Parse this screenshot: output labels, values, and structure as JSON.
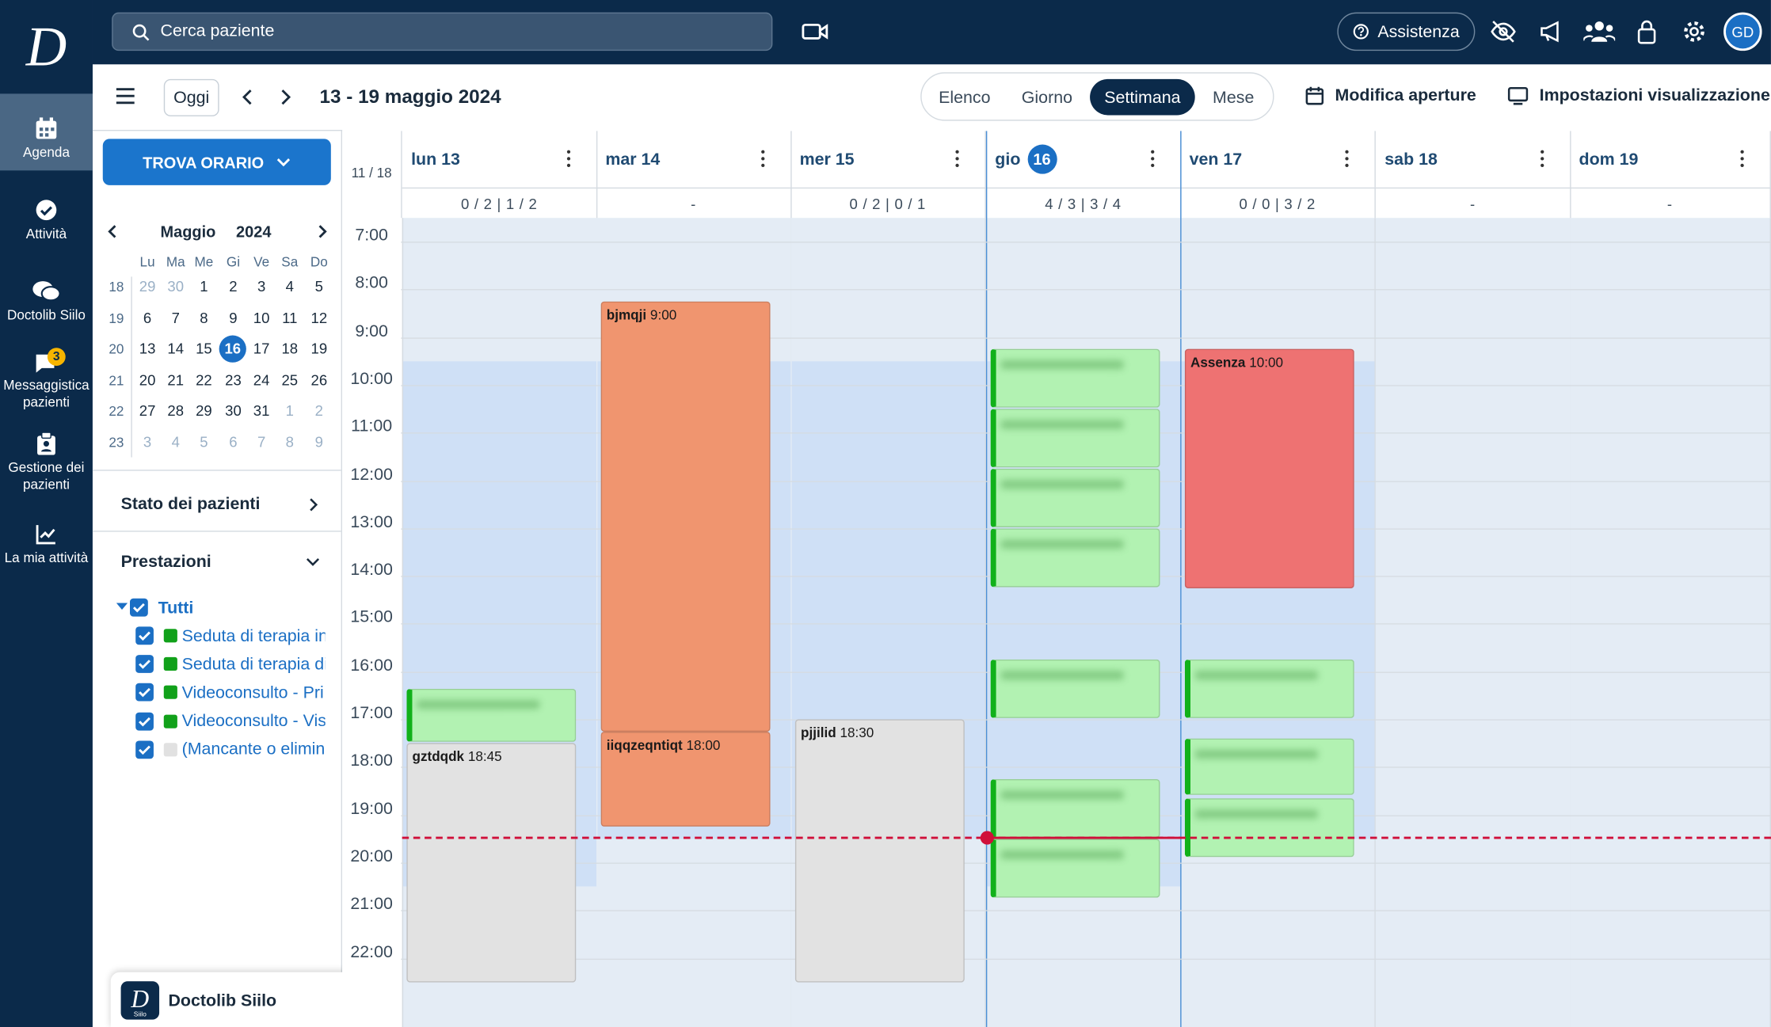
{
  "app": {
    "logo_letter": "D"
  },
  "search": {
    "placeholder": "Cerca paziente"
  },
  "topbar": {
    "assist_label": "Assistenza",
    "avatar_initials": "GD"
  },
  "nav": {
    "agenda": "Agenda",
    "attivita": "Attività",
    "siilo": "Doctolib Siilo",
    "messaggistica_1": "Messaggistica",
    "messaggistica_2": "pazienti",
    "messaggistica_badge": "3",
    "gestione_1": "Gestione dei",
    "gestione_2": "pazienti",
    "mia_attivita": "La mia attività"
  },
  "toolbar": {
    "oggi": "Oggi",
    "date_range": "13 - 19 maggio 2024",
    "views": [
      "Elenco",
      "Giorno",
      "Settimana",
      "Mese"
    ],
    "active_view": "Settimana",
    "modifica_aperture": "Modifica aperture",
    "impostazioni": "Impostazioni visualizzazione"
  },
  "sidebar": {
    "trova_orario": "TROVA ORARIO",
    "month": "Maggio",
    "year": "2024",
    "dow": [
      "Lu",
      "Ma",
      "Me",
      "Gi",
      "Ve",
      "Sa",
      "Do"
    ],
    "weeks": [
      {
        "wk": "18",
        "days": [
          "29",
          "30",
          "1",
          "2",
          "3",
          "4",
          "5"
        ],
        "out": [
          0,
          1
        ]
      },
      {
        "wk": "19",
        "days": [
          "6",
          "7",
          "8",
          "9",
          "10",
          "11",
          "12"
        ],
        "out": []
      },
      {
        "wk": "20",
        "days": [
          "13",
          "14",
          "15",
          "16",
          "17",
          "18",
          "19"
        ],
        "out": [],
        "today": 3
      },
      {
        "wk": "21",
        "days": [
          "20",
          "21",
          "22",
          "23",
          "24",
          "25",
          "26"
        ],
        "out": []
      },
      {
        "wk": "22",
        "days": [
          "27",
          "28",
          "29",
          "30",
          "31",
          "1",
          "2"
        ],
        "out": [
          5,
          6
        ]
      },
      {
        "wk": "23",
        "days": [
          "3",
          "4",
          "5",
          "6",
          "7",
          "8",
          "9"
        ],
        "out": [
          0,
          1,
          2,
          3,
          4,
          5,
          6
        ]
      }
    ],
    "stato_pazienti": "Stato dei pazienti",
    "prestazioni": "Prestazioni",
    "tutti": "Tutti",
    "services": [
      {
        "label": "Seduta di terapia in",
        "color": "#11a11a"
      },
      {
        "label": "Seduta di terapia di",
        "color": "#11a11a"
      },
      {
        "label": "Videoconsulto - Pri",
        "color": "#11a11a"
      },
      {
        "label": "Videoconsulto - Vis",
        "color": "#11a11a"
      },
      {
        "label": "(Mancante o elimin",
        "color": "#e1e1e1"
      }
    ],
    "siilo_panel": "Doctolib Siilo",
    "siilo_logo_sub": "Siilo"
  },
  "calendar": {
    "week_counter": "11 / 18",
    "days": [
      {
        "label": "lun 13",
        "summary": "0 / 2  |  1 / 2"
      },
      {
        "label": "mar 14",
        "summary": "-"
      },
      {
        "label": "mer 15",
        "summary": "0 / 2  |  0 / 1"
      },
      {
        "label": "gio",
        "num": "16",
        "summary": "4 / 3  |  3 / 4"
      },
      {
        "label": "ven 17",
        "summary": "0 / 0  |  3 / 2"
      },
      {
        "label": "sab 18",
        "summary": "-"
      },
      {
        "label": "dom 19",
        "summary": "-"
      }
    ],
    "hours": [
      "7:00",
      "8:00",
      "9:00",
      "10:00",
      "11:00",
      "12:00",
      "13:00",
      "14:00",
      "15:00",
      "16:00",
      "17:00",
      "18:00",
      "19:00",
      "20:00",
      "21:00",
      "22:00"
    ],
    "events": {
      "bjmqji": {
        "name": "bjmqji",
        "time": "9:00",
        "color": "#f0956f"
      },
      "iiqqzeqntiqt": {
        "name": "iiqqzeqntiqt",
        "time": "18:00",
        "color": "#f0956f"
      },
      "gztdqdk": {
        "name": "gztdqdk",
        "time": "18:45",
        "color": "#e2e2e2"
      },
      "pjjilid": {
        "name": "pjjilid",
        "time": "18:30",
        "color": "#e2e2e2"
      },
      "assenza": {
        "name": "Assenza",
        "time": "10:00",
        "color": "#ee7272"
      }
    },
    "current_time_line_color": "#d0103a"
  }
}
